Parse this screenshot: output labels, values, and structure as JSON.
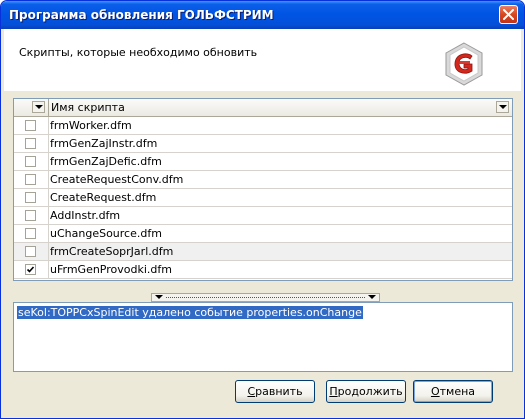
{
  "window": {
    "title": "Программа обновления ГОЛЬФСТРИМ",
    "colors": {
      "titlebar": "#0054e3",
      "selection": "#316ac5",
      "close": "#d7471f",
      "logo": "#d2281e"
    }
  },
  "header": {
    "text": "Скрипты, которые необходимо обновить",
    "logo_icon": "golfstream-logo-icon"
  },
  "grid": {
    "column_header": "Имя скрипта",
    "rows": [
      {
        "name": "frmWorker.dfm",
        "checked": false
      },
      {
        "name": "frmGenZajInstr.dfm",
        "checked": false
      },
      {
        "name": "frmGenZajDefic.dfm",
        "checked": false
      },
      {
        "name": "CreateRequestConv.dfm",
        "checked": false
      },
      {
        "name": "CreateRequest.dfm",
        "checked": false
      },
      {
        "name": "AddInstr.dfm",
        "checked": false
      },
      {
        "name": "uChangeSource.dfm",
        "checked": false
      },
      {
        "name": "frmCreateSoprJarl.dfm",
        "checked": false
      },
      {
        "name": "uFrmGenProvodki.dfm",
        "checked": true
      }
    ]
  },
  "log": {
    "line": "seKol:TOPPCxSpinEdit удалено событие properties.onChange"
  },
  "buttons": {
    "compare": {
      "accel": "С",
      "rest": "равнить"
    },
    "continue": {
      "accel": "П",
      "rest": "родолжить"
    },
    "cancel": {
      "accel": "О",
      "rest": "тмена"
    }
  }
}
